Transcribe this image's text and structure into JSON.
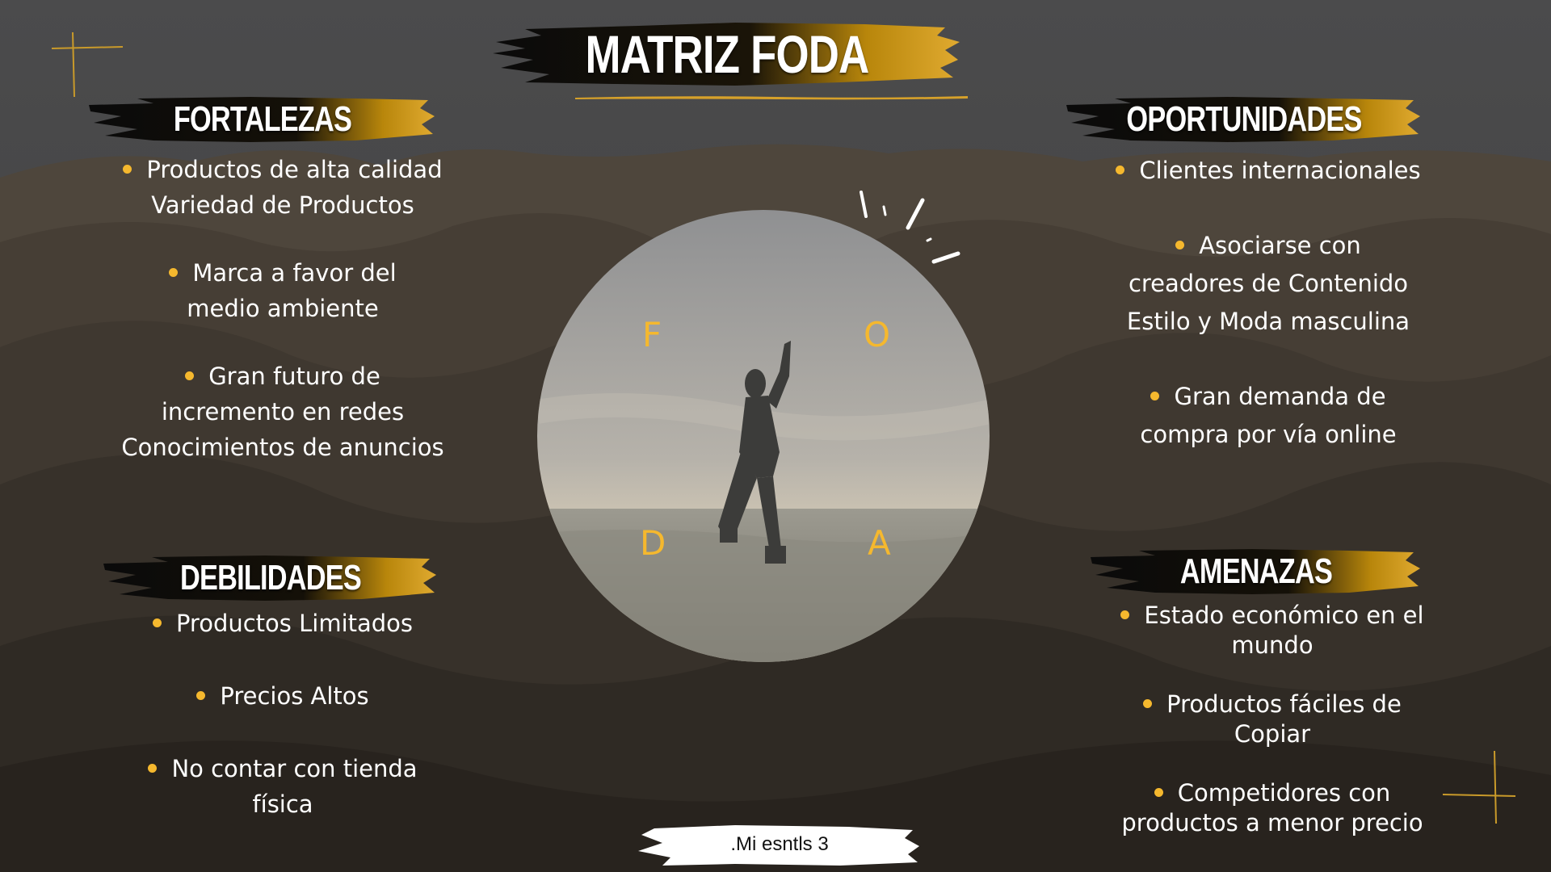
{
  "colors": {
    "accent": "#f5b82e",
    "text": "#ffffff",
    "banner_dark": "#0b0b0b"
  },
  "title": "MATRIZ FODA",
  "sections": {
    "fortalezas": {
      "heading": "FORTALEZAS",
      "items": [
        {
          "lines": [
            "Productos de alta calidad",
            "Variedad de Productos"
          ]
        },
        {
          "lines": [
            "Marca a favor del",
            "medio ambiente"
          ]
        },
        {
          "lines": [
            "Gran futuro de",
            "incremento en redes",
            "Conocimientos de anuncios"
          ]
        }
      ]
    },
    "oportunidades": {
      "heading": "OPORTUNIDADES",
      "items": [
        {
          "lines": [
            "Clientes internacionales"
          ]
        },
        {
          "lines": [
            "Asociarse con",
            "creadores de Contenido",
            "Estilo y Moda masculina"
          ]
        },
        {
          "lines": [
            "Gran demanda de",
            "compra por vía online"
          ]
        }
      ]
    },
    "debilidades": {
      "heading": "DEBILIDADES",
      "items": [
        {
          "lines": [
            "Productos Limitados"
          ]
        },
        {
          "lines": [
            "Precios Altos"
          ]
        },
        {
          "lines": [
            "No contar con tienda",
            "física"
          ]
        }
      ]
    },
    "amenazas": {
      "heading": "AMENAZAS",
      "items": [
        {
          "lines": [
            "Estado económico en el",
            "mundo"
          ]
        },
        {
          "lines": [
            "Productos fáciles de",
            "Copiar"
          ]
        },
        {
          "lines": [
            "Competidores con",
            "productos a menor precio"
          ]
        }
      ]
    }
  },
  "circle_letters": {
    "f": "F",
    "o": "O",
    "d": "D",
    "a": "A"
  },
  "footer": ".Mi esntls  3",
  "icons": [
    "sparkle-icon",
    "cross-line-decoration",
    "bullet-dot-icon"
  ]
}
